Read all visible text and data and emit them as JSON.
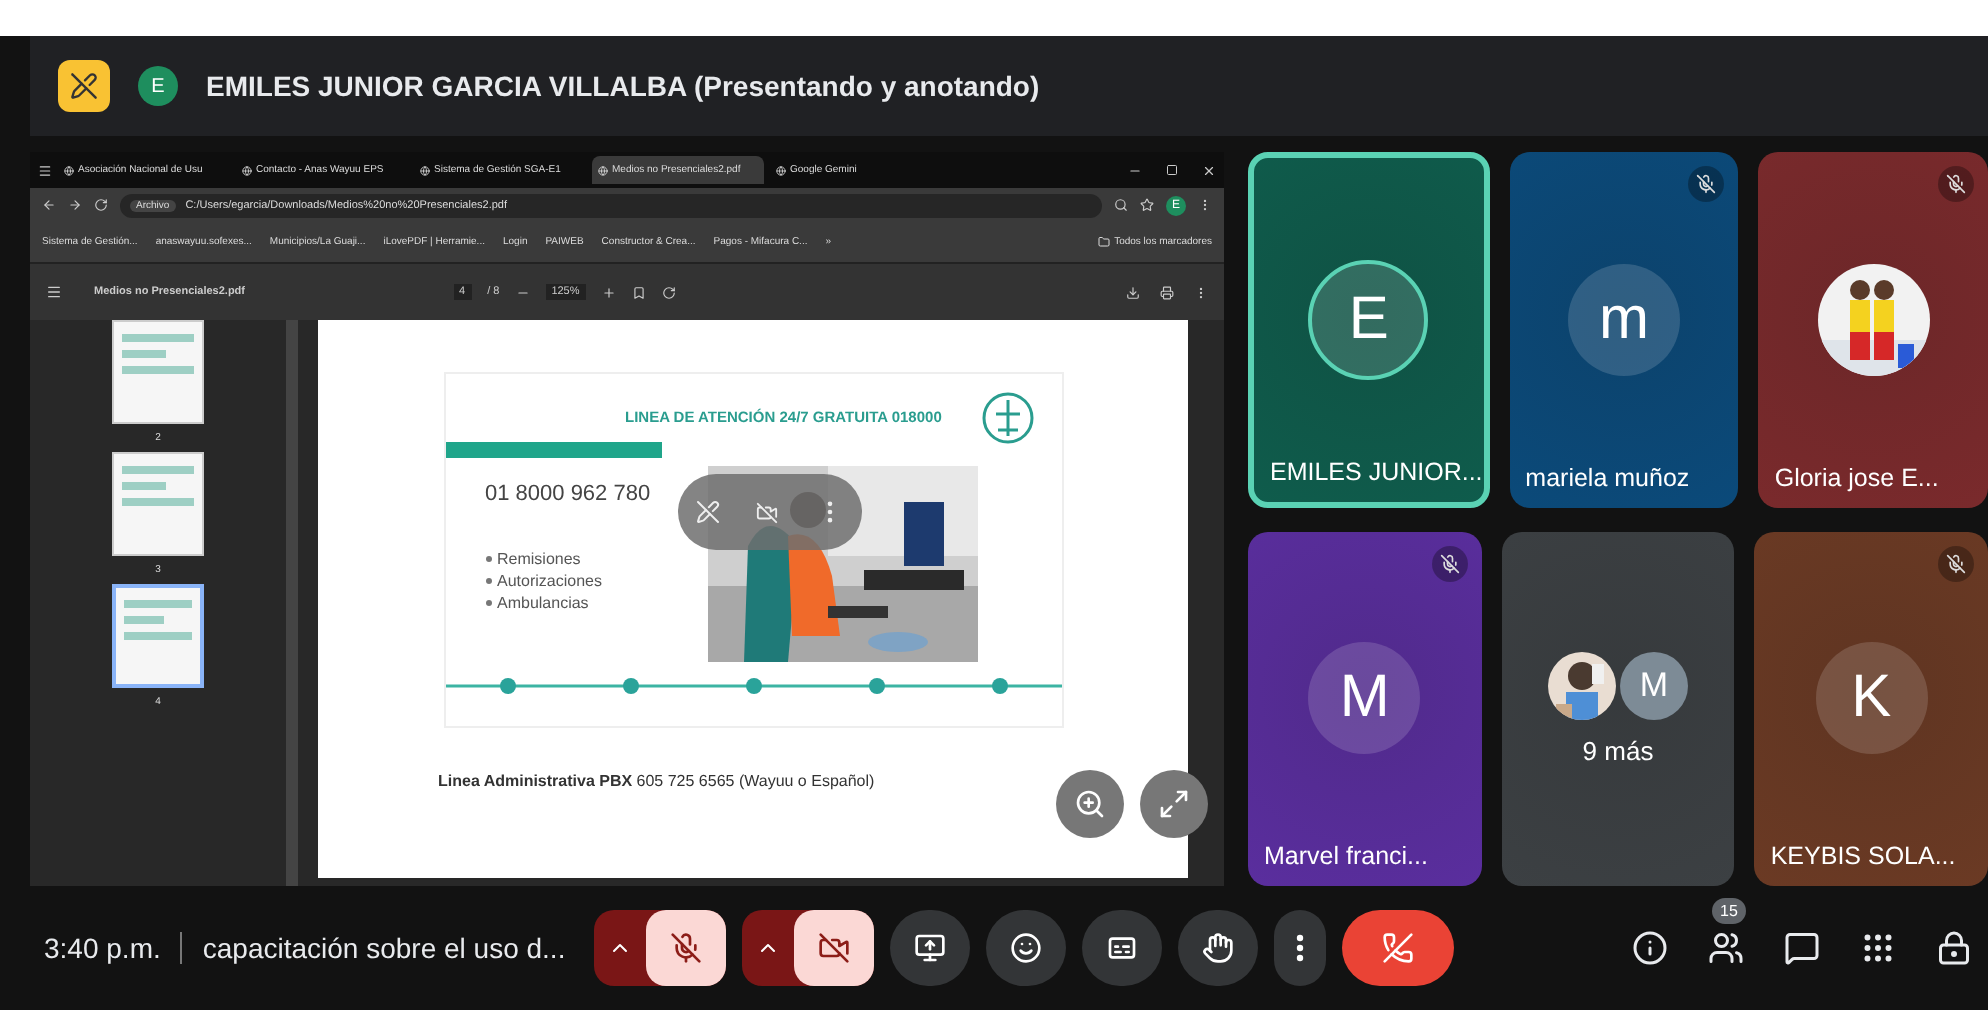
{
  "header": {
    "avatar": "E",
    "title": "EMILES JUNIOR GARCIA VILLALBA (Presentando y anotando)"
  },
  "browser": {
    "tabs": [
      {
        "label": "Asociación Nacional de Usu",
        "selected": false
      },
      {
        "label": "Contacto - Anas Wayuu EPS",
        "selected": false
      },
      {
        "label": "Sistema de Gestión SGA-E1",
        "selected": false
      },
      {
        "label": "Medios no Presenciales2.pdf",
        "selected": true
      },
      {
        "label": "Google Gemini",
        "selected": false
      }
    ],
    "address_chip": "Archivo",
    "address": "C:/Users/egarcia/Downloads/Medios%20no%20Presenciales2.pdf",
    "profile": "E",
    "bookmarks": [
      "Sistema de Gestión...",
      "anaswayuu.sofexes...",
      "Municipios/La Guaji...",
      "iLovePDF | Herramie...",
      "Login",
      "PAIWEB",
      "Constructor & Crea...",
      "Pagos - Mifacura C...",
      "»"
    ],
    "all_bookmarks": "Todos los marcadores"
  },
  "pdf": {
    "file": "Medios no Presenciales2.pdf",
    "page": "4",
    "pages": "/ 8",
    "zoom": "125%",
    "thumbnails": [
      {
        "label": "2",
        "selected": false
      },
      {
        "label": "3",
        "selected": false
      },
      {
        "label": "4",
        "selected": true
      }
    ],
    "slide": {
      "title": "LINEA DE ATENCIÓN 24/7 GRATUITA 018000",
      "phone": "01 8000 962 780",
      "bullets": [
        "Remisiones",
        "Autorizaciones",
        "Ambulancias"
      ]
    },
    "footer": "**Linea Administrativa PBX** 605 725 6565  (Wayuu o Español)"
  },
  "participants": [
    {
      "kind": "avatar",
      "name": "EMILES JUNIOR...",
      "initial": "E",
      "color": "#0f5c4c",
      "speaking": true,
      "muted": false
    },
    {
      "kind": "avatar",
      "name": "mariela muñoz",
      "initial": "m",
      "color": "#0b4a7a",
      "speaking": false,
      "muted": true
    },
    {
      "name": "Gloria jose E...",
      "color": "#7a2a2c",
      "speaking": false,
      "muted": true
    },
    {
      "kind": "avatar",
      "name": "Marvel franci...",
      "initial": "M",
      "color": "#5a2e9e",
      "speaking": false,
      "muted": true
    },
    {
      "kind": "group",
      "more": "9 más",
      "initial": "M",
      "color": "#3c4043",
      "speaking": false,
      "muted": false
    },
    {
      "kind": "avatar",
      "name": "KEYBIS SOLA...",
      "initial": "K",
      "color": "#6b3a24",
      "speaking": false,
      "muted": true
    }
  ],
  "bottom": {
    "time": "3:40 p.m.",
    "meeting": "capacitación sobre el uso d...",
    "mic_on": false,
    "camera_on": false,
    "people_count": "15"
  }
}
